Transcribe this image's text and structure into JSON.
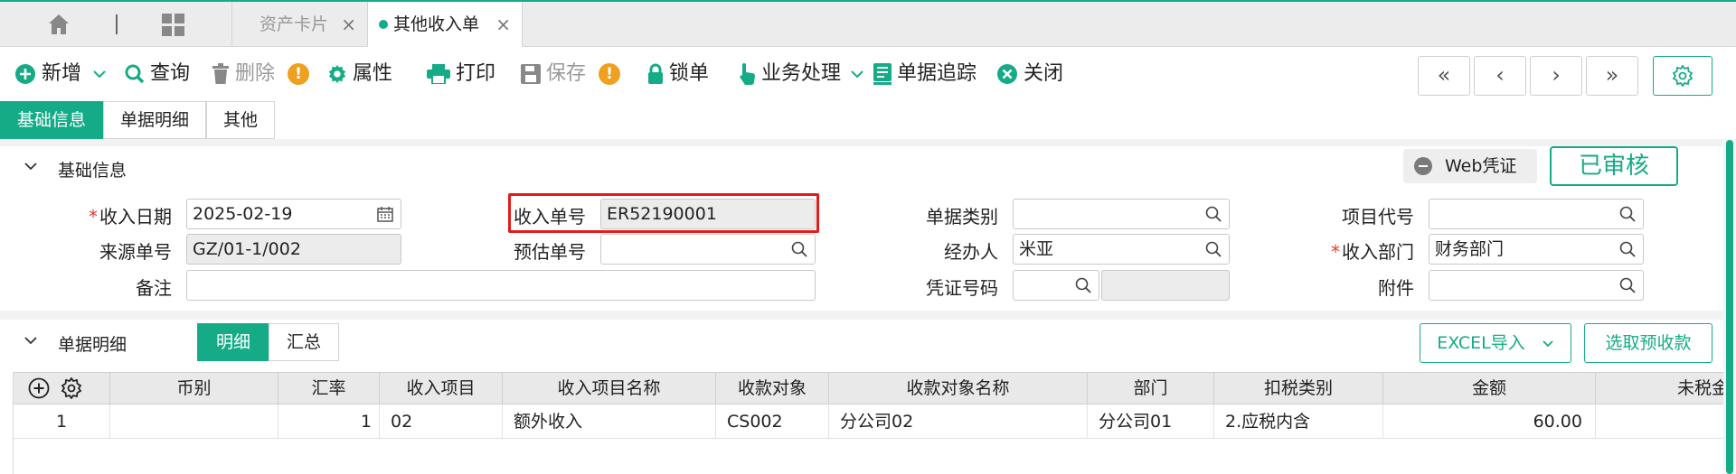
{
  "tabs": [
    {
      "label": "资产卡片",
      "close": "×"
    },
    {
      "label": "其他收入单",
      "close": "×"
    }
  ],
  "toolbar": {
    "new": "新增",
    "query": "查询",
    "delete": "删除",
    "props": "属性",
    "print": "打印",
    "save": "保存",
    "lock": "锁单",
    "business": "业务处理",
    "trace": "单据追踪",
    "close": "关闭",
    "warn_mark": "!",
    "nav": [
      "«",
      "‹",
      "›",
      "»"
    ]
  },
  "subtabs": [
    "基础信息",
    "单据明细",
    "其他"
  ],
  "basic_section": {
    "title": "基础信息",
    "web_voucher": "Web凭证",
    "status": "已审核"
  },
  "form": {
    "income_date": {
      "label": "收入日期",
      "value": "2025-02-19"
    },
    "source_no": {
      "label": "来源单号",
      "value": "GZ/01-1/002"
    },
    "remark": {
      "label": "备注",
      "value": ""
    },
    "income_no": {
      "label": "收入单号",
      "value": "ER52190001"
    },
    "estimate_no": {
      "label": "预估单号",
      "value": ""
    },
    "doc_type": {
      "label": "单据类别",
      "value": ""
    },
    "handler": {
      "label": "经办人",
      "value": "米亚"
    },
    "voucher_no": {
      "label": "凭证号码",
      "value": ""
    },
    "project_code": {
      "label": "项目代号",
      "value": ""
    },
    "income_dept": {
      "label": "收入部门",
      "value": "财务部门"
    },
    "attachment": {
      "label": "附件",
      "value": ""
    }
  },
  "detail_section": {
    "title": "单据明细",
    "seg": [
      "明细",
      "汇总"
    ],
    "excel_import": "EXCEL导入",
    "select_prepay": "选取预收款"
  },
  "grid": {
    "headers": [
      "币别",
      "汇率",
      "收入项目",
      "收入项目名称",
      "收款对象",
      "收款对象名称",
      "部门",
      "扣税类别",
      "金额",
      "未税金"
    ],
    "rows": [
      {
        "no": "1",
        "currency": "",
        "rate": "1",
        "item": "02",
        "item_name": "额外收入",
        "payee": "CS002",
        "payee_name": "分公司02",
        "dept": "分公司01",
        "tax_type": "2.应税内含",
        "amount": "60.00",
        "untaxed": ""
      }
    ]
  },
  "colors": {
    "accent": "#16ab87",
    "required": "#e53935",
    "warn": "#f0a020",
    "highlight": "#e21b1b"
  }
}
